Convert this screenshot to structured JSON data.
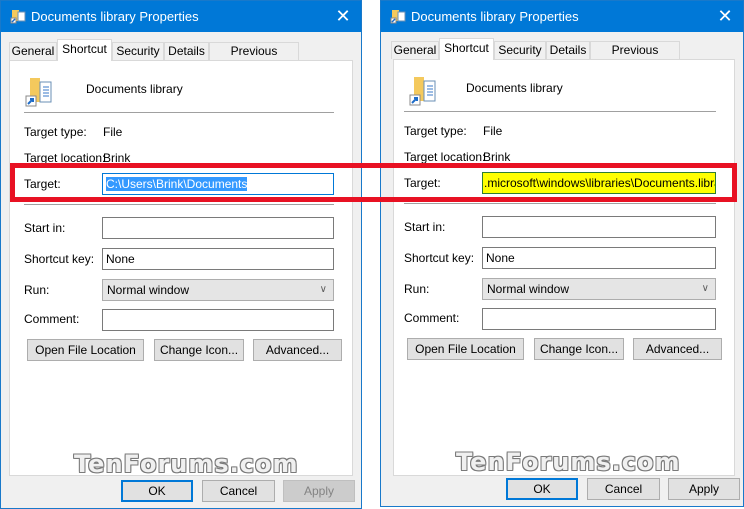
{
  "dialogs": [
    {
      "title": "Documents library Properties",
      "close_glyph": "✕",
      "tabs": [
        "General",
        "Shortcut",
        "Security",
        "Details",
        "Previous Versions"
      ],
      "active_tab": "Shortcut",
      "item_name": "Documents library",
      "target_type_label": "Target type:",
      "target_type_value": "File",
      "target_location_label": "Target location:",
      "target_location_value": "Brink",
      "target_label": "Target:",
      "target_value": "C:\\Users\\Brink\\Documents",
      "start_in_label": "Start in:",
      "start_in_value": "",
      "shortcut_key_label": "Shortcut key:",
      "shortcut_key_value": "None",
      "run_label": "Run:",
      "run_value": "Normal window",
      "comment_label": "Comment:",
      "comment_value": "",
      "open_file_location": "Open File Location",
      "change_icon": "Change Icon...",
      "advanced": "Advanced...",
      "ok": "OK",
      "cancel": "Cancel",
      "apply": "Apply",
      "apply_enabled": false
    },
    {
      "title": "Documents library Properties",
      "close_glyph": "✕",
      "tabs": [
        "General",
        "Shortcut",
        "Security",
        "Details",
        "Previous Versions"
      ],
      "active_tab": "Shortcut",
      "item_name": "Documents library",
      "target_type_label": "Target type:",
      "target_type_value": "File",
      "target_location_label": "Target location:",
      "target_location_value": "Brink",
      "target_label": "Target:",
      "target_value": ".microsoft\\windows\\libraries\\Documents.library-ms",
      "start_in_label": "Start in:",
      "start_in_value": "",
      "shortcut_key_label": "Shortcut key:",
      "shortcut_key_value": "None",
      "run_label": "Run:",
      "run_value": "Normal window",
      "comment_label": "Comment:",
      "comment_value": "",
      "open_file_location": "Open File Location",
      "change_icon": "Change Icon...",
      "advanced": "Advanced...",
      "ok": "OK",
      "cancel": "Cancel",
      "apply": "Apply",
      "apply_enabled": true
    }
  ],
  "watermark": "TenForums.com",
  "colors": {
    "titlebar": "#0078d7",
    "highlight_box": "#e81123",
    "target_highlight": "#ffff00",
    "selection": "#3399ff"
  }
}
